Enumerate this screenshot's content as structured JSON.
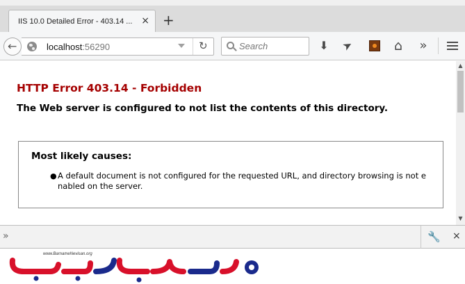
{
  "browser": {
    "tab": {
      "title": "IIS 10.0 Detailed Error - 403.14 ...",
      "close_icon": "×"
    },
    "new_tab_icon": "+",
    "nav": {
      "back_icon": "←",
      "url_host": "localhost",
      "url_port": ":56290",
      "reload_icon": "↻",
      "search_placeholder": "Search"
    },
    "toolbar": {
      "download_icon": "⬇",
      "send_icon": "➤",
      "home_icon": "⌂",
      "overflow_icon": "»"
    }
  },
  "page": {
    "title": "HTTP Error 403.14 - Forbidden",
    "subtitle": "The Web server is configured to not list the contents of this directory.",
    "causes": {
      "heading": "Most likely causes:",
      "items": [
        "A default document is not configured for the requested URL, and directory browsing is not enabled on the server."
      ]
    }
  },
  "command_bar": {
    "prompt_icon": "»",
    "wrench_icon": "🔧",
    "close_icon": "×"
  },
  "watermark": {
    "url": "www.BarnameNevisan.org",
    "logo_text": "برنامه نویسان"
  },
  "colors": {
    "error_red": "#a50000",
    "logo_red": "#d8102a",
    "logo_blue": "#1a2a8c"
  }
}
